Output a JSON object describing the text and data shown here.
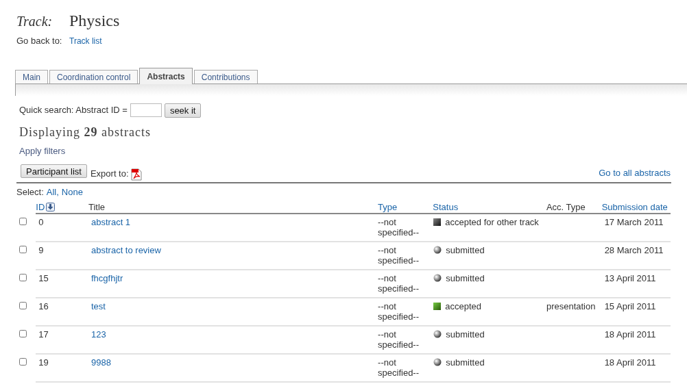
{
  "header": {
    "label": "Track:",
    "title": "Physics",
    "back_label": "Go back to:",
    "back_link": "Track list"
  },
  "tabs": [
    {
      "label": "Main",
      "selected": false
    },
    {
      "label": "Coordination control",
      "selected": false
    },
    {
      "label": "Abstracts",
      "selected": true
    },
    {
      "label": "Contributions",
      "selected": false
    }
  ],
  "quick_search": {
    "label": "Quick search: Abstract ID =",
    "button": "seek it"
  },
  "heading": "Displaying **29** abstracts",
  "apply_filters": "Apply filters",
  "participant_button": "Participant list",
  "export_label": "Export to:",
  "all_link": "Go to all abstracts",
  "select": {
    "label": "Select:",
    "all": "All,",
    "none": "None"
  },
  "table": {
    "columns": [
      {
        "label": "ID",
        "link": true,
        "sort_icon": true
      },
      {
        "label": "Title",
        "link": false
      },
      {
        "label": "Type",
        "link": true
      },
      {
        "label": "Status",
        "link": true
      },
      {
        "label": "Acc. Type",
        "link": false
      },
      {
        "label": "Submission date",
        "link": true
      }
    ],
    "rows": [
      {
        "checked": false,
        "id": "0",
        "title": "abstract 1",
        "type": "--not specified--",
        "kind": "other_track",
        "status": "accepted for other track",
        "date": "17 March 2011"
      },
      {
        "checked": false,
        "id": "9",
        "title": "abstract to review",
        "type": "--not specified--",
        "kind": "submitted",
        "status": "submitted",
        "date": "28 March 2011"
      },
      {
        "checked": false,
        "id": "15",
        "title": "fhcgfhjtr",
        "type": "--not specified--",
        "kind": "submitted",
        "status": "submitted",
        "date": "13 April 2011"
      },
      {
        "checked": false,
        "id": "16",
        "title": "test",
        "type": "--not specified--",
        "kind": "accepted",
        "status": "accepted",
        "acc_type": "presentation",
        "date": "15 April 2011"
      },
      {
        "checked": false,
        "id": "17",
        "title": "123",
        "type": "--not specified--",
        "kind": "submitted",
        "status": "submitted",
        "date": "18 April 2011"
      },
      {
        "checked": false,
        "id": "19",
        "title": "9988",
        "type": "--not specified--",
        "kind": "submitted",
        "status": "submitted",
        "date": "18 April 2011"
      }
    ]
  }
}
